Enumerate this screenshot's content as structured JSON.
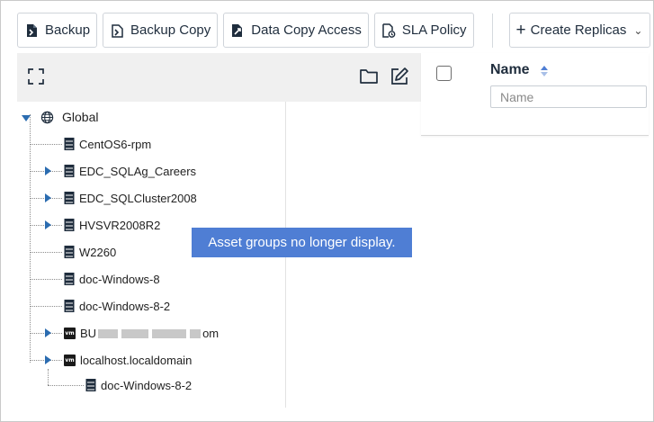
{
  "toolbar": {
    "backup_label": "Backup",
    "backup_copy_label": "Backup Copy",
    "data_copy_access_label": "Data Copy Access",
    "sla_policy_label": "SLA Policy",
    "create_replicas_label": "Create Replicas"
  },
  "tree": {
    "root": "Global",
    "items": [
      {
        "label": "CentOS6-rpm",
        "icon": "server-icon",
        "expandable": false
      },
      {
        "label": "EDC_SQLAg_Careers",
        "icon": "server-icon",
        "expandable": true
      },
      {
        "label": "EDC_SQLCluster2008",
        "icon": "server-icon",
        "expandable": true
      },
      {
        "label": "HVSVR2008R2",
        "icon": "server-icon",
        "expandable": true
      },
      {
        "label": "W2260",
        "icon": "server-icon",
        "expandable": false
      },
      {
        "label": "doc-Windows-8",
        "icon": "server-icon",
        "expandable": false
      },
      {
        "label": "doc-Windows-8-2",
        "icon": "server-icon",
        "expandable": false
      },
      {
        "label_prefix": "BU",
        "label_suffix": "om",
        "icon": "vm-icon",
        "expandable": true
      },
      {
        "label": "localhost.localdomain",
        "icon": "vm-icon",
        "expandable": true,
        "expanded": true
      }
    ],
    "child": {
      "label": "doc-Windows-8-2",
      "icon": "server-icon"
    },
    "vm_badge": "vm"
  },
  "tooltip": "Asset groups no longer display.",
  "grid": {
    "column_title": "Name",
    "filter_placeholder": "Name"
  },
  "colors": {
    "accent": "#2b6cb0",
    "tooltip_bg": "#4f7ed4",
    "header_bg": "#f0f0f0"
  }
}
